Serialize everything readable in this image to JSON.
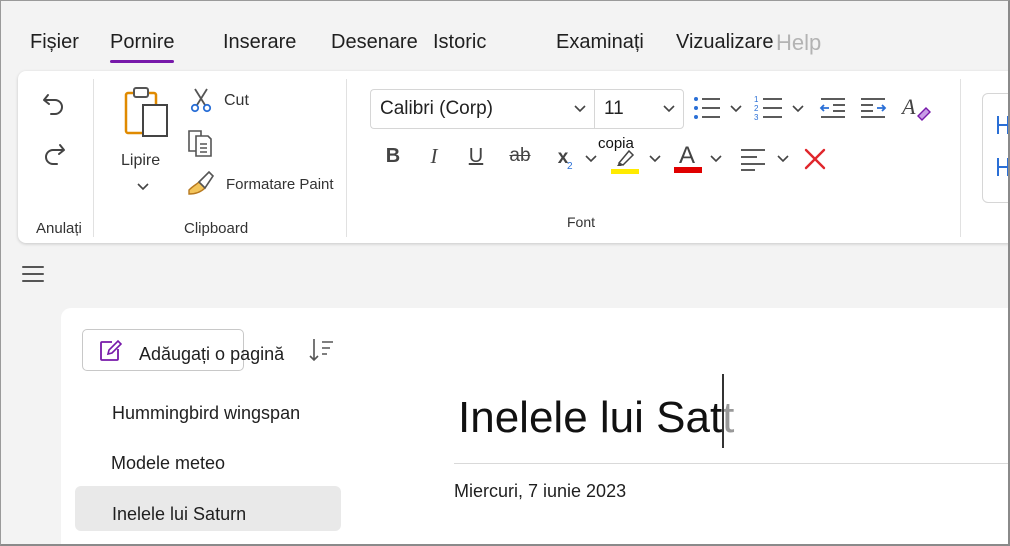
{
  "menu": {
    "tabs": [
      {
        "label": "Fișier"
      },
      {
        "label": "Pornire",
        "active": true
      },
      {
        "label": "Inserare"
      },
      {
        "label": "Desenare"
      },
      {
        "label": "Istoric"
      },
      {
        "label": "Examinați"
      },
      {
        "label": "Vizualizare"
      },
      {
        "label": "Help"
      }
    ]
  },
  "ribbon": {
    "undo_group": {
      "label": "Anulați",
      "undo_icon": "undo-icon",
      "redo_icon": "redo-icon"
    },
    "clipboard": {
      "label": "Clipboard",
      "paste_label": "Lipire",
      "cut_label": "Cut",
      "copy_label": "copia",
      "format_painter_label": "Formatare Paint"
    },
    "font": {
      "label": "Font",
      "font_name": "Calibri (Corp)",
      "font_size": "11",
      "bold": "B",
      "italic": "I",
      "underline": "U",
      "strike": "ab",
      "subscript": "x",
      "subscript_mark": "2",
      "font_color_letter": "A",
      "highlight_color": "#ffeb00",
      "font_color": "#e00000",
      "accent": "#7719aa"
    }
  },
  "pages": {
    "add_page_label": "Adăugați o pagină",
    "items": [
      {
        "label": "Hummingbird wingspan"
      },
      {
        "label": "Modele meteo"
      },
      {
        "label": "Inelele lui Saturn",
        "selected": true
      }
    ]
  },
  "page": {
    "title": "Inelele lui Sat",
    "title_cursor_char": "t",
    "date": "Miercuri, 7 iunie 2023"
  }
}
